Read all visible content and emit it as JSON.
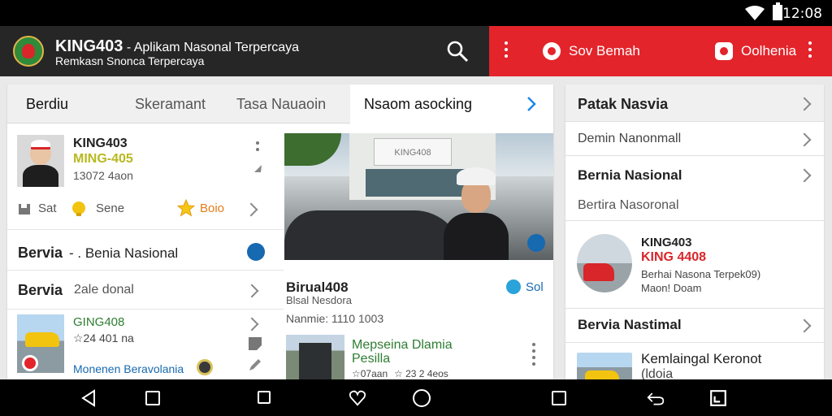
{
  "status_bar": {
    "time": "12:08"
  },
  "app_bar": {
    "title": "KING403",
    "title_suffix": " - Aplikam Nasonal Terpercaya",
    "subtitle": "Remkasn Snonca Terpercaya"
  },
  "red_bar": {
    "pill1": "Sov Bemah",
    "pill2": "Oolhenia"
  },
  "tabs": [
    "Berdiu",
    "Skeramant",
    "Tasa Nauaoin",
    "Nsaom asocking"
  ],
  "left": {
    "profile": {
      "name": "KING403",
      "alt_name": "MING-405",
      "meta": "13072 4aon"
    },
    "actions": {
      "save": "Sat",
      "share": "Sene",
      "rating": "Boio"
    },
    "row1": {
      "title": "Bervia",
      "text": "- . Benia Nasional"
    },
    "row2": {
      "title": "Bervia",
      "text": "2ale donal"
    },
    "item": {
      "title": "GING408",
      "rating": "☆24 401 na",
      "link": "Monenen Beravolania"
    }
  },
  "mid": {
    "sign": "KING408",
    "post": {
      "title": "Birual408",
      "sub": "Blsal Nesdora",
      "meta": "Nanmie: 1110 1003",
      "tag": "Sol"
    },
    "item": {
      "title1": "Mepseina Dlamia",
      "title2": "Pesilla",
      "meta1": "☆07aan",
      "meta2": "☆ 23 2 4eos"
    }
  },
  "side": {
    "rows": [
      "Patak Nasvia",
      "Demin Nanonmall",
      "Bernia Nasional",
      "Bertira Nasoronal"
    ],
    "profile": {
      "name": "KING403",
      "alt": "KING 4408",
      "line1": "Berhai Nasona Terpek09)",
      "line2": "Maon! Doam"
    },
    "row5": "Bervia Nastimal",
    "item": {
      "title": "Kemlaingal Keronot",
      "sub": "(ldoia"
    }
  },
  "colors": {
    "brand_red": "#e3242b",
    "dark_bar": "#262626",
    "accent_blue": "#1769b0",
    "accent_green": "#2e7d32",
    "rating_orange": "#e27d17"
  }
}
